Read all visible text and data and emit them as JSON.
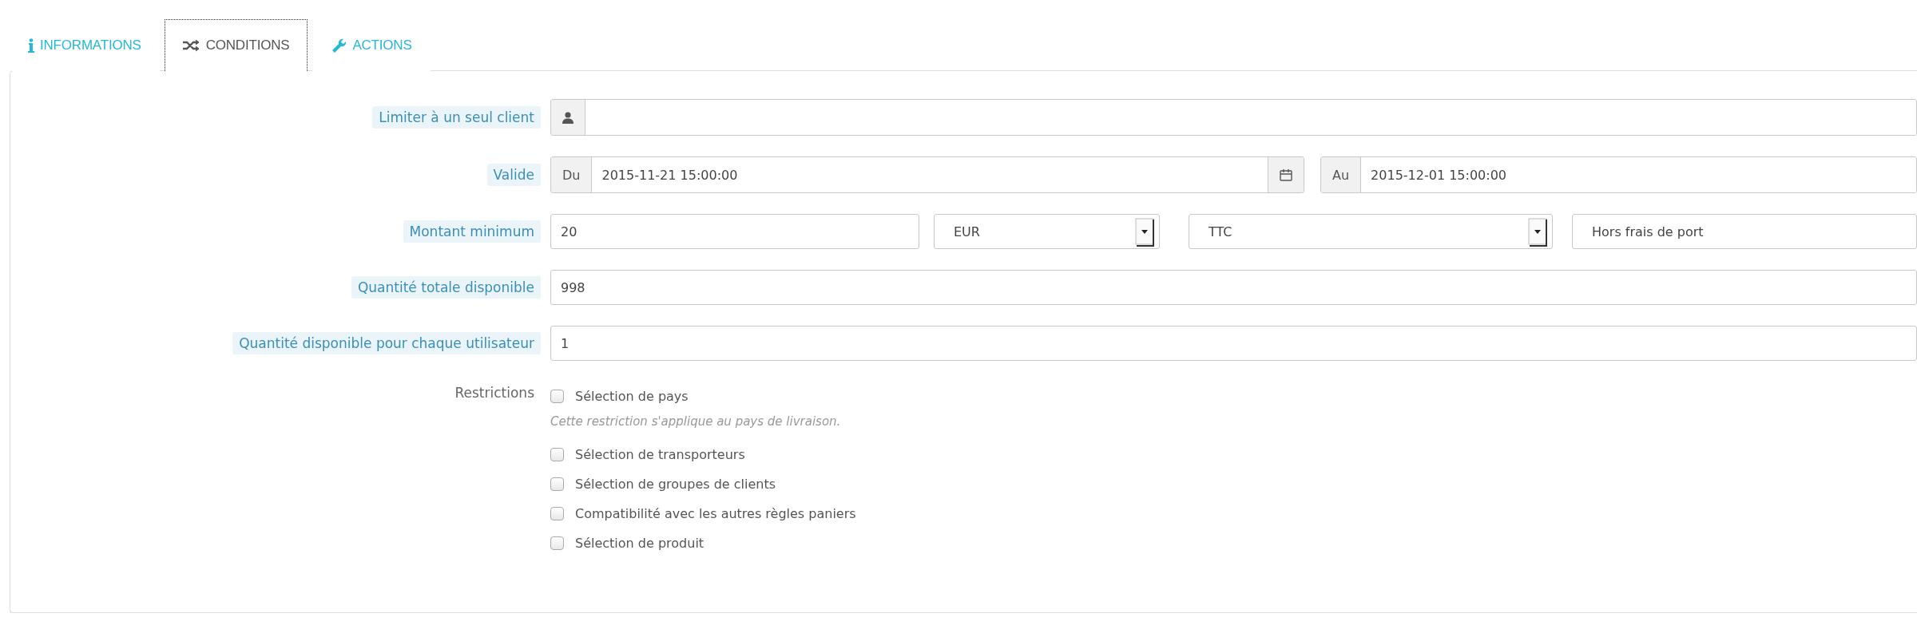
{
  "tabs": [
    {
      "label": "INFORMATIONS",
      "kind": "info",
      "selected": false
    },
    {
      "label": "CONDITIONS",
      "kind": "shuffle",
      "selected": true
    },
    {
      "label": "ACTIONS",
      "kind": "wrench",
      "selected": false
    }
  ],
  "rows": [
    {
      "kind": "client",
      "label": "Limiter à un seul client"
    },
    {
      "kind": "date_range",
      "label": "Valide",
      "from": {
        "prefix": "Du",
        "value": "2015-11-21 15:00:00"
      },
      "to": {
        "prefix": "Au",
        "value": "2015-12-01 15:00:00"
      }
    },
    {
      "kind": "amount",
      "label": "Montant minimum",
      "value": "20",
      "currency": "EUR",
      "tax": "TTC",
      "shipping": "Hors frais de port"
    },
    {
      "kind": "text",
      "label": "Quantité totale disponible",
      "value": "998"
    },
    {
      "kind": "text",
      "label": "Quantité disponible pour chaque utilisateur",
      "value": "1"
    }
  ],
  "restrictions": {
    "label": "Restrictions",
    "items": [
      {
        "label": "Sélection de pays",
        "checked": false,
        "hint": "Cette restriction s'applique au pays de livraison."
      },
      {
        "label": "Sélection de transporteurs",
        "checked": false
      },
      {
        "label": "Sélection de groupes de clients",
        "checked": false
      },
      {
        "label": "Compatibilité avec les autres règles paniers",
        "checked": false
      },
      {
        "label": "Sélection de produit",
        "checked": false
      }
    ]
  }
}
